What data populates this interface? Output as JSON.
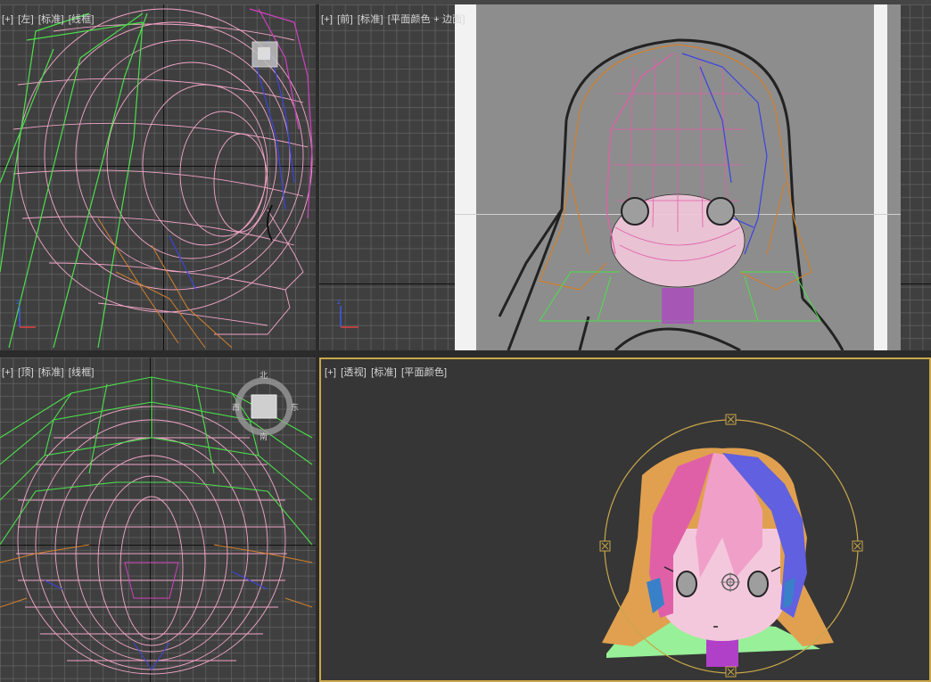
{
  "viewports": {
    "left": {
      "plus": "[+]",
      "view": "[左]",
      "shading": "[标准]",
      "mode": "[线框]"
    },
    "front": {
      "plus": "[+]",
      "view": "[前]",
      "shading": "[标准]",
      "mode": "[平面颜色 + 边面]"
    },
    "top": {
      "plus": "[+]",
      "view": "[顶]",
      "shading": "[标准]",
      "mode": "[线框]",
      "compass": {
        "north": "北",
        "west": "西",
        "east": "东",
        "south": "南",
        "face": "上"
      }
    },
    "perspective": {
      "plus": "[+]",
      "view": "[透视]",
      "shading": "[标准]",
      "mode": "[平面颜色]"
    }
  },
  "colors": {
    "background": "#3f3f3f",
    "active_border": "#c9a74a",
    "wire_pink": "#f2a6c8",
    "wire_green": "#4be04b",
    "wire_orange": "#d2802a",
    "wire_blue": "#3a44e0",
    "wire_magenta": "#d040c0",
    "hair_orange": "#e0a050",
    "hair_pink": "#e060a8",
    "hair_blue": "#6060e0",
    "skin": "#f4c8dc",
    "neck": "#b040c8",
    "shoulder_green": "#98f098"
  },
  "icons": [
    "viewcube-icon",
    "axis-tripod-icon",
    "compass-ring-icon",
    "pivot-gizmo-icon"
  ]
}
